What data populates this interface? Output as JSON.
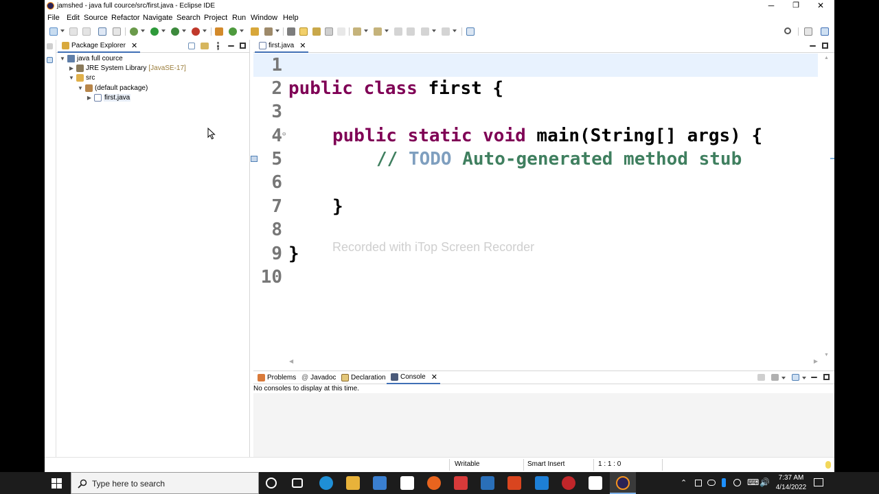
{
  "window": {
    "title": "jamshed - java full cource/src/first.java - Eclipse IDE",
    "minimize": "─",
    "restore": "❐",
    "close": "✕"
  },
  "menu": [
    "File",
    "Edit",
    "Source",
    "Refactor",
    "Navigate",
    "Search",
    "Project",
    "Run",
    "Window",
    "Help"
  ],
  "package_explorer": {
    "tab_label": "Package Explorer",
    "tree": [
      {
        "label": "java full cource",
        "icon": "java-project-icon",
        "expanded": true
      },
      {
        "label": "JRE System Library",
        "extra": "[JavaSE-17]",
        "icon": "library-icon",
        "expanded": false
      },
      {
        "label": "src",
        "icon": "source-folder-icon",
        "expanded": true
      },
      {
        "label": "(default package)",
        "icon": "package-icon",
        "expanded": true
      },
      {
        "label": "first.java",
        "icon": "java-file-icon",
        "expanded": false
      }
    ]
  },
  "editor": {
    "tab_label": "first.java",
    "line_numbers": [
      "1",
      "2",
      "3",
      "4",
      "5",
      "6",
      "7",
      "8",
      "9",
      "10"
    ],
    "code": {
      "l2_kw": "public class",
      "l2_rest": " first {",
      "l4_kw": "public static void",
      "l4_rest": " main(String[] args) {",
      "l5_comment": "// ",
      "l5_todo": "TODO",
      "l5_rest": " Auto-generated method stub",
      "l7": "}",
      "l9": "}"
    },
    "watermark": "Recorded with iTop Screen Recorder"
  },
  "bottom_panel": {
    "tabs": [
      "Problems",
      "Javadoc",
      "Declaration",
      "Console"
    ],
    "active_tab": "Console",
    "message": "No consoles to display at this time."
  },
  "status_bar": {
    "writable": "Writable",
    "insert_mode": "Smart Insert",
    "position": "1 : 1 : 0"
  },
  "taskbar": {
    "search_placeholder": "Type here to search",
    "time": "7:37 AM",
    "date": "4/14/2022"
  }
}
